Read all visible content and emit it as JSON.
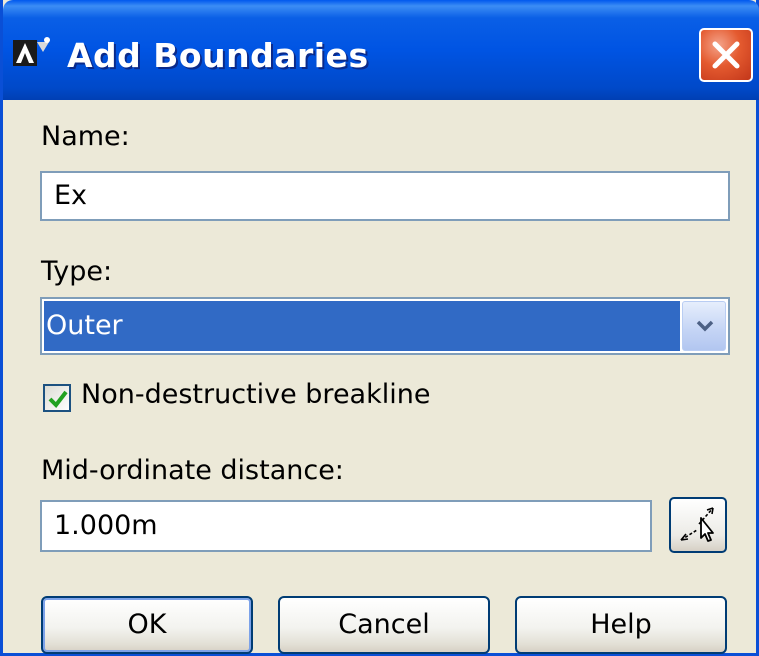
{
  "window": {
    "title": "Add Boundaries"
  },
  "form": {
    "name_label": "Name:",
    "name_value": "Ex",
    "type_label": "Type:",
    "type_value": "Outer",
    "checkbox_label": "Non-destructive breakline",
    "checkbox_checked": true,
    "distance_label": "Mid-ordinate distance:",
    "distance_value": "1.000m"
  },
  "buttons": {
    "ok": "OK",
    "cancel": "Cancel",
    "help": "Help"
  },
  "icons": {
    "app": "autodesk-civil-icon",
    "close": "close-icon",
    "dropdown": "chevron-down-icon",
    "check": "checkmark-icon",
    "pick": "pick-distance-icon"
  },
  "colors": {
    "titlebar": "#0054e3",
    "selection": "#316ac5",
    "close": "#e45a2f",
    "dialog_bg": "#ece9d8"
  }
}
